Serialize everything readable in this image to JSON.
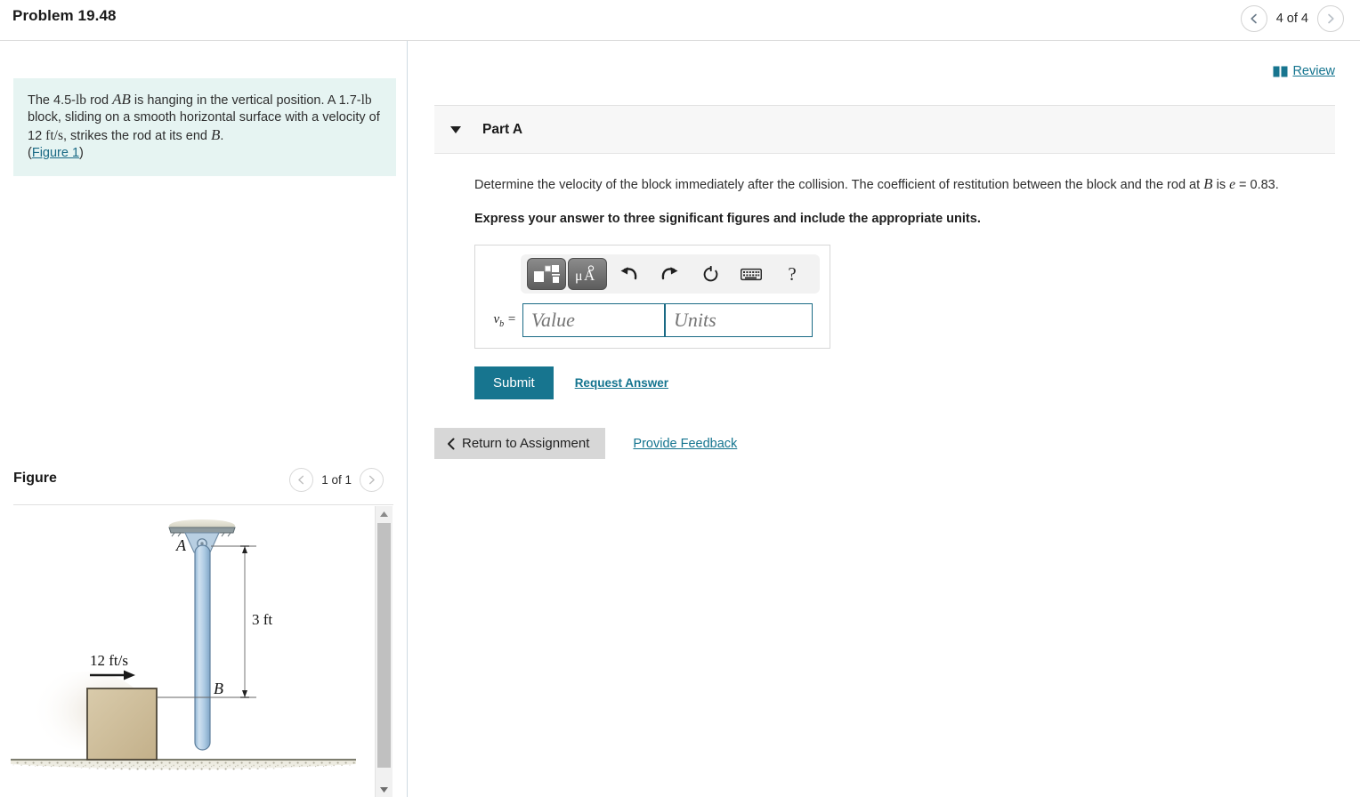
{
  "header": {
    "title": "Problem 19.48",
    "pager": {
      "prev_icon": "chevron-left-icon",
      "label": "4 of 4",
      "next_icon": "chevron-right-icon"
    }
  },
  "left_panel": {
    "problem_statement": {
      "part1": "The 4.5-",
      "unit_lb1": "lb",
      "part2": " rod ",
      "var_ab": "AB",
      "part3": " is hanging in the vertical position. A 1.7-",
      "unit_lb2": "lb",
      "part4": " block, sliding on a smooth horizontal surface with a velocity of 12 ",
      "unit_fts": "ft/s",
      "part5": ", strikes the rod at its end ",
      "var_b": "B",
      "part6": ".",
      "open_paren": "(",
      "figure_link": "Figure 1",
      "close_paren": ")"
    },
    "figure_section": {
      "title": "Figure",
      "pager": {
        "prev_icon": "chevron-left-icon",
        "label": "1 of 1",
        "next_icon": "chevron-right-icon"
      },
      "scrollbar": {
        "up_icon": "scroll-up-arrow-icon",
        "down_icon": "scroll-down-arrow-icon"
      },
      "diagram": {
        "label_a": "A",
        "label_b": "B",
        "dimension": "3 ft",
        "velocity": "12 ft/s",
        "colors": {
          "rod": "#aec9e0",
          "block": "#cdbb9a",
          "ground": "#e5e3d8",
          "support": "#d8d7c6"
        }
      }
    }
  },
  "right_panel": {
    "review": {
      "icon": "book-icon",
      "label": "Review"
    },
    "part_a": {
      "caret_icon": "caret-down-icon",
      "label": "Part A",
      "question": {
        "part1": "Determine the velocity of the block immediately after the collision. The coefficient of restitution between the block and the rod at ",
        "var_b": "B",
        "part2": " is ",
        "var_e": "e",
        "part3": " = 0.83."
      },
      "instruction": "Express your answer to three significant figures and include the appropriate units.",
      "toolbar": {
        "template_icon": "math-template-icon",
        "units_icon": "micro-angstrom-units-icon",
        "undo_icon": "undo-arrow-icon",
        "redo_icon": "redo-arrow-icon",
        "reset_icon": "reset-circle-icon",
        "keyboard_icon": "keyboard-icon",
        "help_icon": "question-mark-icon",
        "help_label": "?"
      },
      "answer": {
        "variable": "v",
        "variable_sub": "b",
        "equals": "=",
        "value_placeholder": "Value",
        "value": "",
        "units_placeholder": "Units",
        "units": ""
      },
      "submit_label": "Submit",
      "request_answer_label": "Request Answer"
    },
    "footer": {
      "return_icon": "chevron-left-icon",
      "return_label": "Return to Assignment",
      "provide_feedback_label": "Provide Feedback"
    }
  },
  "colors": {
    "accent": "#17758f",
    "link": "#14748f",
    "statement_bg": "#e6f4f2",
    "panel_border": "#cfdae3"
  }
}
